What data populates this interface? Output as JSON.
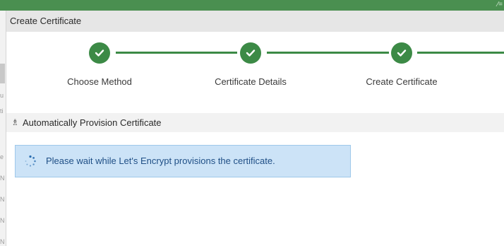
{
  "window": {
    "corner_icon": "pin-icon"
  },
  "dialog": {
    "title": "Create Certificate"
  },
  "stepper": {
    "steps": [
      {
        "label": "Choose Method",
        "status": "complete"
      },
      {
        "label": "Certificate Details",
        "status": "complete"
      },
      {
        "label": "Create Certificate",
        "status": "complete"
      }
    ],
    "accent_color": "#3c8a46"
  },
  "section": {
    "icon": "certificate-icon",
    "title": "Automatically Provision Certificate"
  },
  "message": {
    "icon": "spinner-icon",
    "text": "Please wait while Let's Encrypt provisions the certificate.",
    "background_color": "#cce3f7",
    "text_color": "#1f4f86"
  }
}
